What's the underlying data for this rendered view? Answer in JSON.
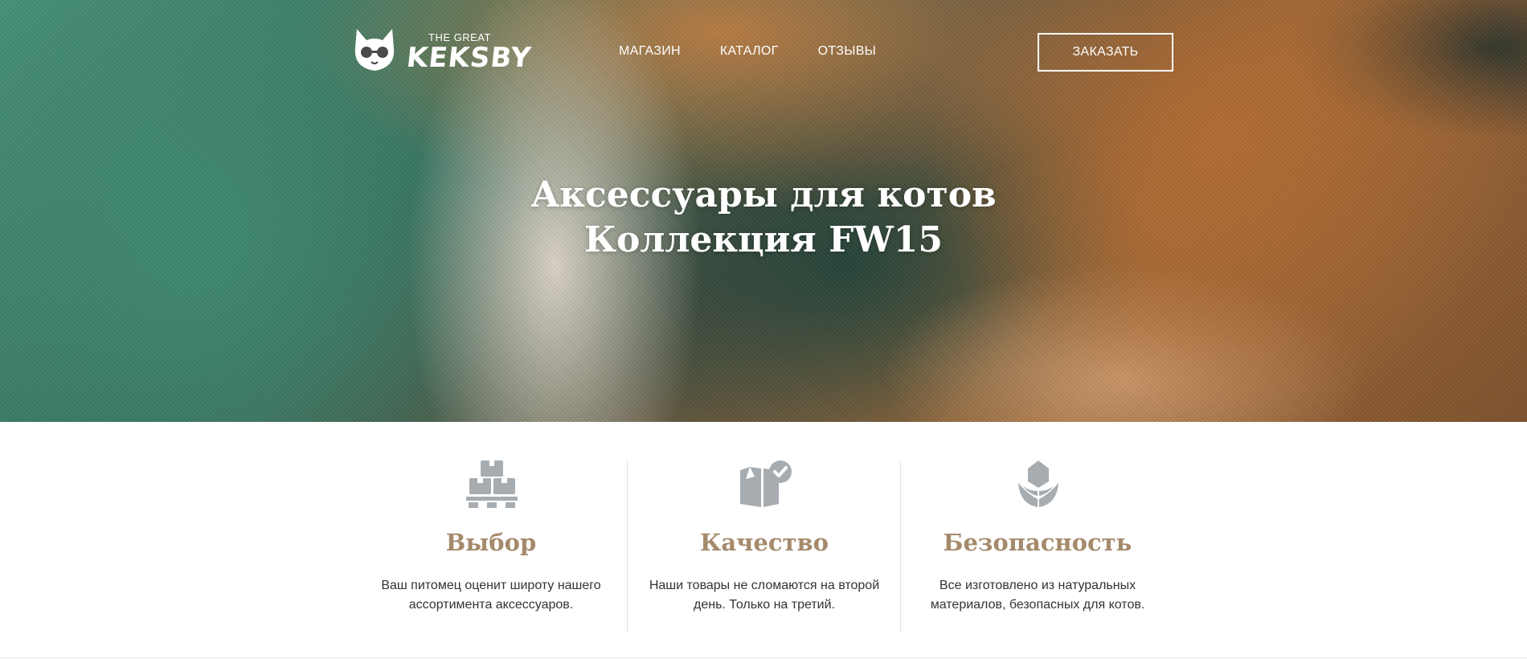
{
  "header": {
    "logo": {
      "small": "THE GREAT",
      "big": "KEKSBY",
      "icon": "cat-with-glasses-icon"
    },
    "nav": [
      {
        "label": "МАГАЗИН"
      },
      {
        "label": "КАТАЛОГ"
      },
      {
        "label": "ОТЗЫВЫ"
      }
    ],
    "order_button": "ЗАКАЗАТЬ"
  },
  "hero": {
    "title_line1": "Аксессуары для котов",
    "title_line2": "Коллекция FW15"
  },
  "features": [
    {
      "icon": "boxes-on-pallet-icon",
      "title": "Выбор",
      "text": "Ваш питомец оценит широту нашего ассортимента аксессуаров."
    },
    {
      "icon": "box-with-checkmark-icon",
      "title": "Качество",
      "text": "Наши товары не сломаются на второй день. Только на третий."
    },
    {
      "icon": "flower-bud-icon",
      "title": "Безопасность",
      "text": "Все изготовлено из натуральных материалов, безопасных для котов."
    }
  ],
  "colors": {
    "accent_title": "#a58a6b",
    "icon_gray": "#a7acb1",
    "text": "#333333",
    "white": "#ffffff"
  }
}
